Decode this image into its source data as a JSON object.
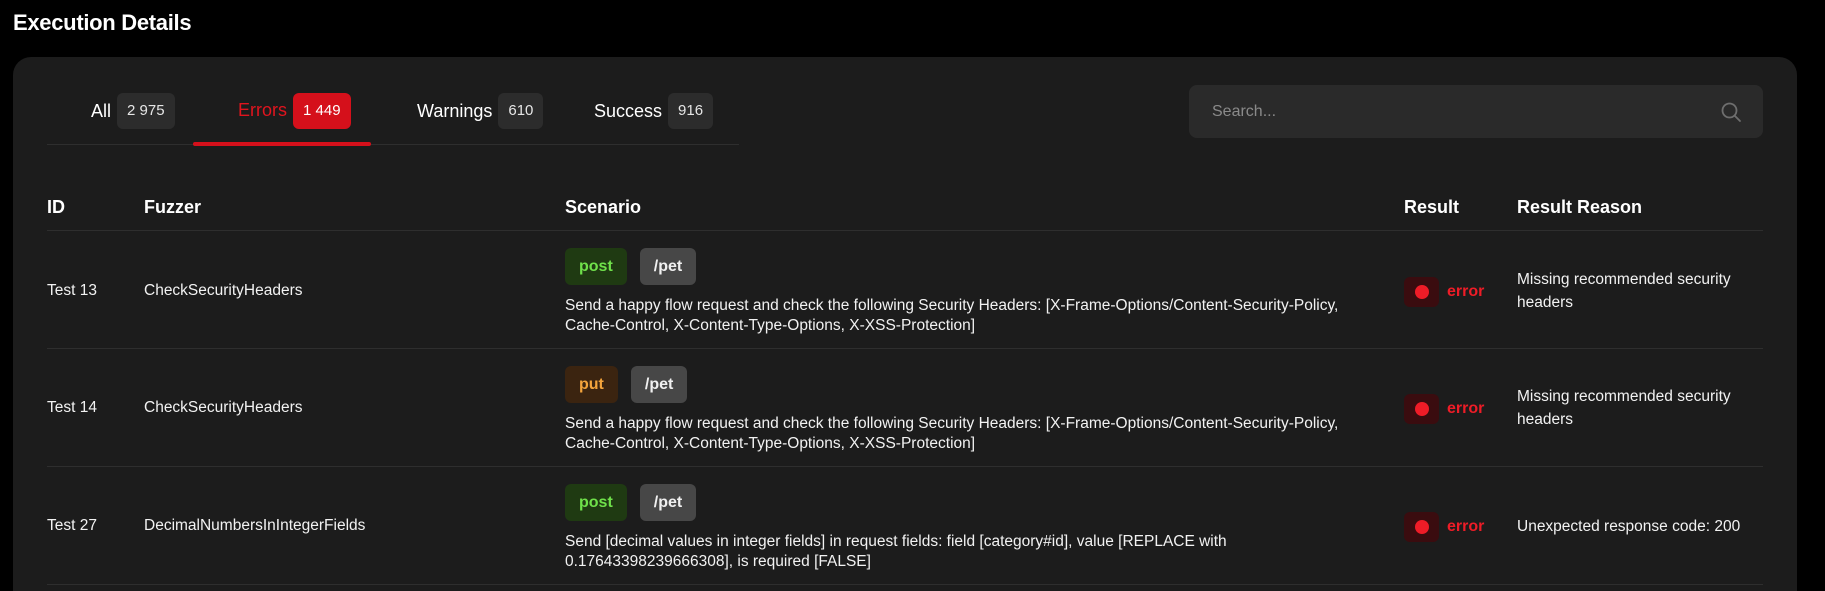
{
  "page_title": "Execution Details",
  "tabs": [
    {
      "label": "All",
      "count": "2 975"
    },
    {
      "label": "Errors",
      "count": "1 449"
    },
    {
      "label": "Warnings",
      "count": "610"
    },
    {
      "label": "Success",
      "count": "916"
    }
  ],
  "active_tab": "Errors",
  "search": {
    "placeholder": "Search...",
    "value": ""
  },
  "columns": [
    "ID",
    "Fuzzer",
    "Scenario",
    "Result",
    "Result Reason"
  ],
  "rows": [
    {
      "id": "Test 13",
      "fuzzer": "CheckSecurityHeaders",
      "method": "post",
      "path": "/pet",
      "scenario": "Send a happy flow request and check the following Security Headers: [X-Frame-Options/Content-Security-Policy, Cache-Control, X-Content-Type-Options, X-XSS-Protection]",
      "result": "error",
      "reason": " Missing recommended security headers"
    },
    {
      "id": "Test 14",
      "fuzzer": "CheckSecurityHeaders",
      "method": "put",
      "path": "/pet",
      "scenario": "Send a happy flow request and check the following Security Headers: [X-Frame-Options/Content-Security-Policy, Cache-Control, X-Content-Type-Options, X-XSS-Protection]",
      "result": "error",
      "reason": " Missing recommended security headers"
    },
    {
      "id": "Test 27",
      "fuzzer": "DecimalNumbersInIntegerFields",
      "method": "post",
      "path": "/pet",
      "scenario": "Send [decimal values in integer fields] in request fields: field [category#id], value [REPLACE with 0.17643398239666308], is required [FALSE]",
      "result": "error",
      "reason": " Unexpected response code: 200"
    }
  ],
  "colors": {
    "background": "#000000",
    "panel": "#1c1c1c",
    "accent_error": "#ee1c27",
    "method_post": "#6fe04a",
    "method_put": "#f4a43c"
  },
  "icons": {
    "search": "search-icon",
    "result": "error-dot-icon"
  }
}
